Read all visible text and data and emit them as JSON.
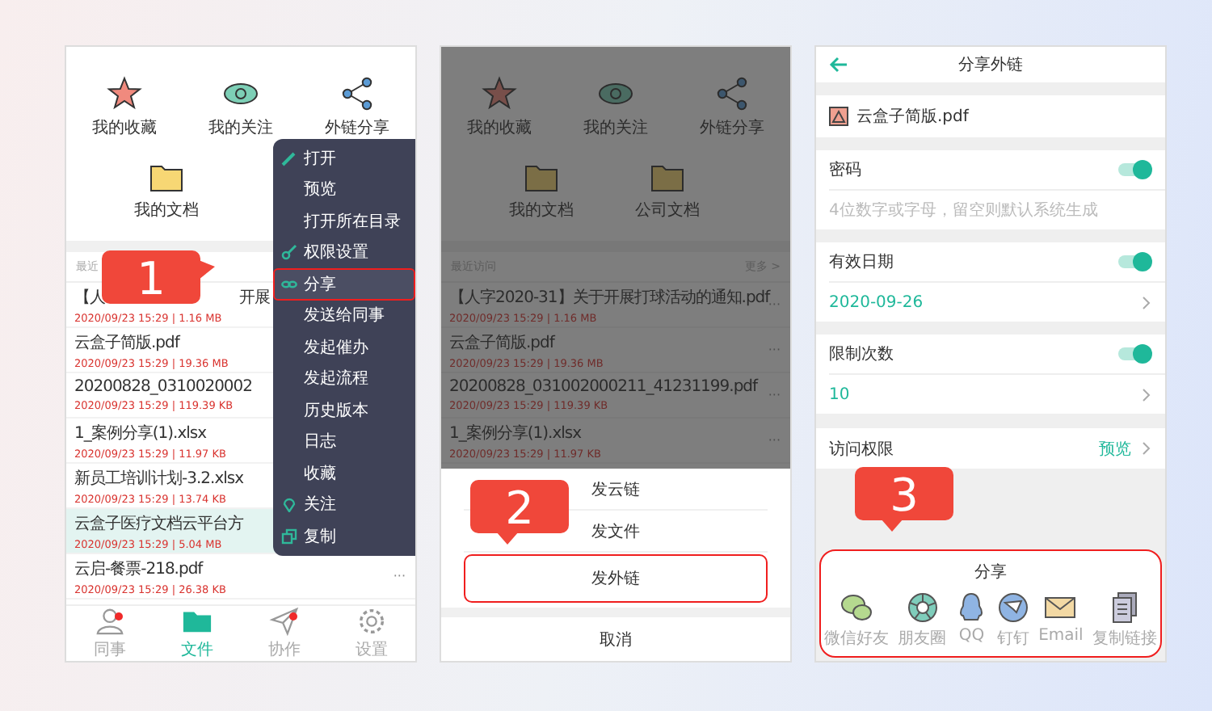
{
  "screen_1": {
    "step_badge": "1",
    "shortcuts": [
      {
        "label": "我的收藏",
        "kind": "star"
      },
      {
        "label": "我的关注",
        "kind": "eye"
      },
      {
        "label": "外链分享",
        "kind": "share"
      }
    ],
    "folders": [
      {
        "label": "我的文档"
      }
    ],
    "recent_label": "最近",
    "files": [
      {
        "title": "【人",
        "title_tail": "开展",
        "meta": "2020/09/23 15:29 | 1.16 MB",
        "selected": false
      },
      {
        "title": "云盒子简版.pdf",
        "meta": "2020/09/23 15:29 | 19.36 MB",
        "selected": false
      },
      {
        "title": "20200828_0310020002",
        "meta": "2020/09/23 15:29 | 119.39 KB",
        "selected": false
      },
      {
        "title": "1_案例分享(1).xlsx",
        "meta": "2020/09/23 15:29 | 11.97 KB",
        "selected": false
      },
      {
        "title": "新员工培训计划-3.2.xlsx",
        "meta": "2020/09/23 15:29 | 13.74 KB",
        "selected": false
      },
      {
        "title": "云盒子医疗文档云平台方",
        "meta": "2020/09/23 15:29 | 5.04 MB",
        "selected": true
      },
      {
        "title": "云启-餐票-218.pdf",
        "meta": "2020/09/23 15:29 | 26.38 KB",
        "more": "···",
        "selected": false
      }
    ],
    "context_menu": [
      {
        "label": "打开",
        "kind": "pencil",
        "selected": false
      },
      {
        "label": "预览",
        "kind": "plain",
        "selected": false
      },
      {
        "label": "打开所在目录",
        "kind": "plain",
        "selected": false
      },
      {
        "label": "权限设置",
        "kind": "key",
        "selected": false
      },
      {
        "label": "分享",
        "kind": "link",
        "selected": true
      },
      {
        "label": "发送给同事",
        "kind": "plain",
        "selected": false
      },
      {
        "label": "发起催办",
        "kind": "plain",
        "selected": false
      },
      {
        "label": "发起流程",
        "kind": "plain",
        "selected": false
      },
      {
        "label": "历史版本",
        "kind": "plain",
        "selected": false
      },
      {
        "label": "日志",
        "kind": "plain",
        "selected": false
      },
      {
        "label": "收藏",
        "kind": "plain",
        "selected": false
      },
      {
        "label": "关注",
        "kind": "pin",
        "selected": false
      },
      {
        "label": "复制",
        "kind": "copy",
        "selected": false
      }
    ],
    "tab_bar": [
      {
        "label": "同事",
        "kind": "person",
        "badge": true,
        "selected": false
      },
      {
        "label": "文件",
        "kind": "folder",
        "badge": false,
        "selected": true
      },
      {
        "label": "协作",
        "kind": "plane",
        "badge": true,
        "selected": false
      },
      {
        "label": "设置",
        "kind": "gear",
        "badge": false,
        "selected": false
      }
    ]
  },
  "screen_2": {
    "step_badge": "2",
    "shortcuts": [
      {
        "label": "我的收藏",
        "kind": "star"
      },
      {
        "label": "我的关注",
        "kind": "eye"
      },
      {
        "label": "外链分享",
        "kind": "share"
      }
    ],
    "folders": [
      {
        "label": "我的文档"
      },
      {
        "label": "公司文档"
      }
    ],
    "recent_label": "最近访问",
    "more_link": "更多 >",
    "files": [
      {
        "title": "【人字2020-31】关于开展打球活动的通知.pdf",
        "meta": "2020/09/23 15:29 | 1.16 MB",
        "more": "···",
        "selected": false
      },
      {
        "title": "云盒子简版.pdf",
        "meta": "2020/09/23 15:29 | 19.36 MB",
        "more": "···",
        "selected": false
      },
      {
        "title": "20200828_031002000211_41231199.pdf",
        "meta": "2020/09/23 15:29 | 119.39 KB",
        "more": "···",
        "selected": false
      },
      {
        "title": "1_案例分享(1).xlsx",
        "meta": "2020/09/23 15:29 | 11.97 KB",
        "more": "···",
        "selected": false
      }
    ],
    "action_sheet": [
      {
        "label": "发云链",
        "selected": false
      },
      {
        "label": "发文件",
        "selected": false
      },
      {
        "label": "发外链",
        "selected": true
      }
    ],
    "cancel": "取消"
  },
  "screen_3": {
    "step_badge": "3",
    "header": {
      "title": "分享外链"
    },
    "file": {
      "name": "云盒子简版.pdf"
    },
    "settings": [
      {
        "label": "密码",
        "on": true,
        "placeholder": "4位数字或字母，留空则默认系统生成"
      },
      {
        "label": "有效日期",
        "on": true,
        "value": "2020-09-26"
      },
      {
        "label": "限制次数",
        "on": true,
        "value": "10"
      }
    ],
    "access": {
      "label": "访问权限",
      "value": "预览"
    },
    "share_panel": {
      "title": "分享",
      "targets": [
        {
          "label": "微信好友",
          "kind": "wechat"
        },
        {
          "label": "朋友圈",
          "kind": "aperture"
        },
        {
          "label": "QQ",
          "kind": "penguin"
        },
        {
          "label": "钉钉",
          "kind": "wing"
        },
        {
          "label": "Email",
          "kind": "email"
        },
        {
          "label": "复制链接",
          "kind": "copy"
        }
      ]
    }
  }
}
